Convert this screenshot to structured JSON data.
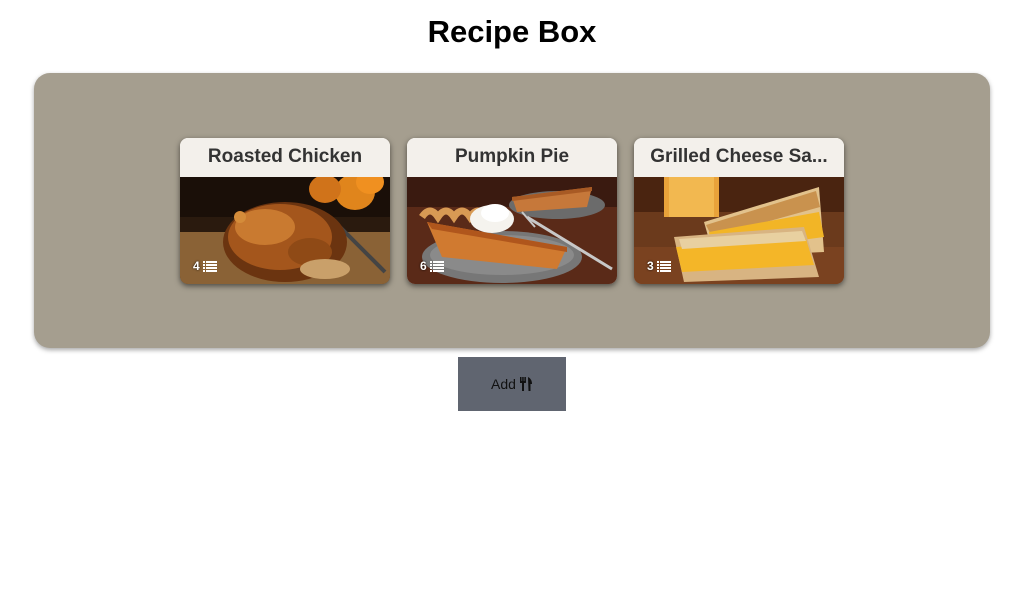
{
  "header": {
    "title": "Recipe Box"
  },
  "recipes": [
    {
      "name": "Roasted Chicken",
      "ingredient_count": "4",
      "image_icon": "roasted-chicken-photo"
    },
    {
      "name": "Pumpkin Pie",
      "ingredient_count": "6",
      "image_icon": "pumpkin-pie-photo"
    },
    {
      "name": "Grilled Cheese Sa...",
      "ingredient_count": "3",
      "image_icon": "grilled-cheese-photo"
    }
  ],
  "actions": {
    "add_label": "Add",
    "add_icon": "utensils-icon"
  },
  "colors": {
    "panel": "#a59e8f",
    "card_header": "#f3f0eb",
    "add_button": "#606570"
  }
}
